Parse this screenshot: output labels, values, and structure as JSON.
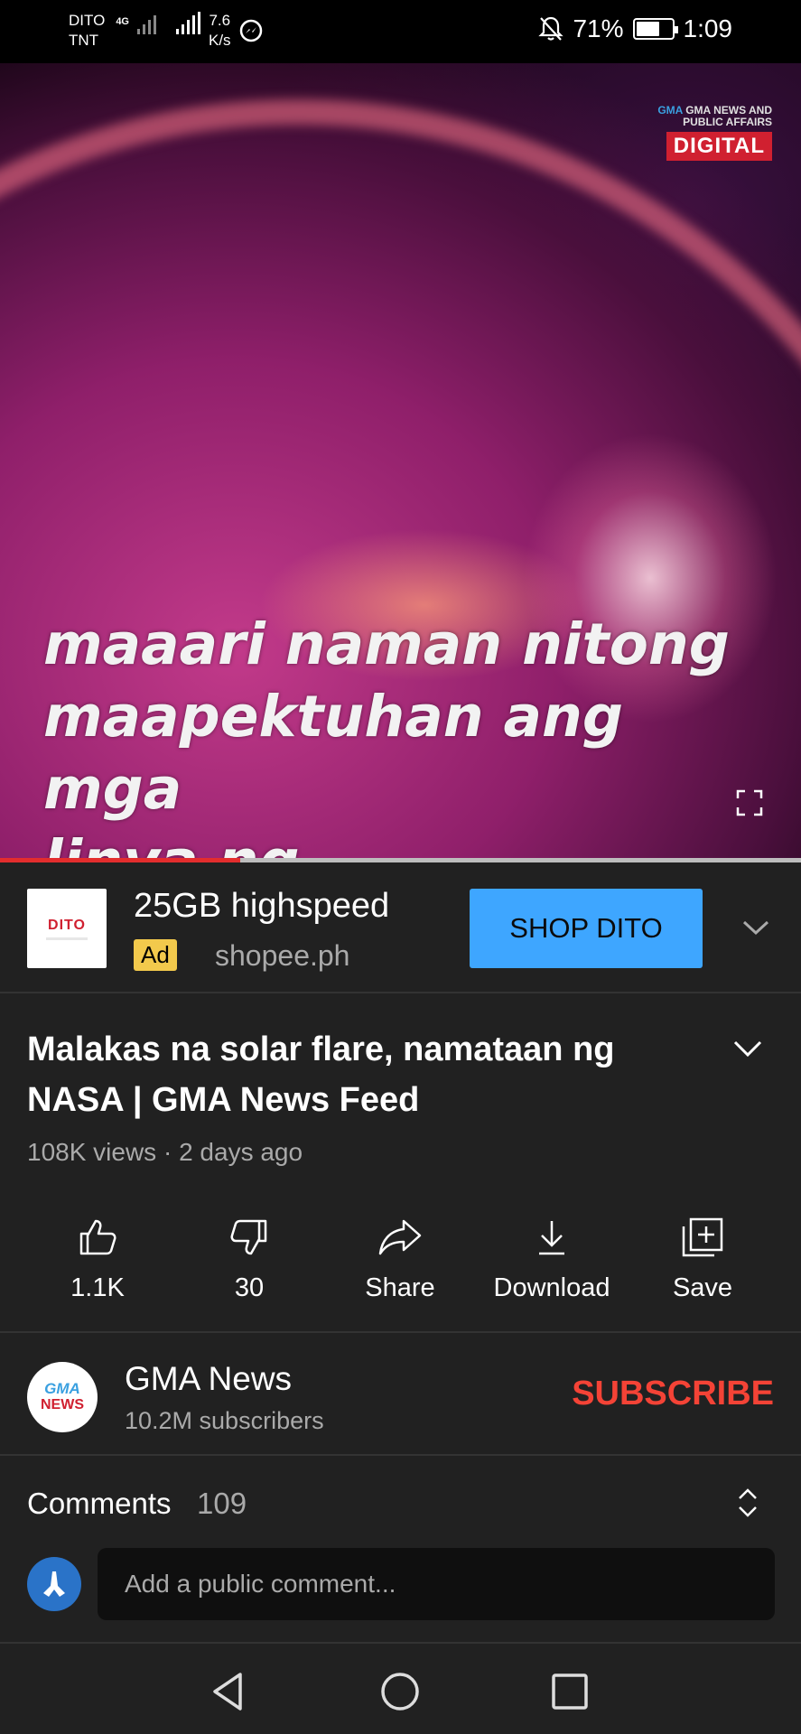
{
  "status_bar": {
    "carrier1": "DITO",
    "carrier2": "TNT",
    "network": "4G",
    "speed_value": "7.6",
    "speed_unit": "K/s",
    "battery_text": "71%",
    "battery_level": 0.71,
    "time": "1:09"
  },
  "video": {
    "channel_logo_line1": "GMA NEWS AND",
    "channel_logo_line2": "PUBLIC AFFAIRS",
    "channel_logo_digital": "DIGITAL",
    "caption_line1": "maaari naman nitong",
    "caption_line2": "maapektuhan ang mga",
    "caption_line3": "linya ng komunikasyon.",
    "progress": 0.3
  },
  "ad": {
    "logo_text": "DITO",
    "title": "25GB highspeed",
    "badge": "Ad",
    "domain": "shopee.ph",
    "cta": "SHOP DITO"
  },
  "video_info": {
    "title": "Malakas na solar flare, namataan ng NASA | GMA News Feed",
    "meta": "108K views · 2 days ago"
  },
  "actions": [
    {
      "label": "1.1K",
      "icon": "thumbs-up-icon"
    },
    {
      "label": "30",
      "icon": "thumbs-down-icon"
    },
    {
      "label": "Share",
      "icon": "share-icon"
    },
    {
      "label": "Download",
      "icon": "download-icon"
    },
    {
      "label": "Save",
      "icon": "save-playlist-icon"
    }
  ],
  "channel": {
    "avatar_line1": "GMA",
    "avatar_line2": "NEWS",
    "name": "GMA News",
    "subscribers": "10.2M subscribers",
    "subscribe_label": "SUBSCRIBE"
  },
  "comments": {
    "label": "Comments",
    "count": "109",
    "placeholder": "Add a public comment..."
  },
  "colors": {
    "accent_red": "#e32d2d",
    "cta_blue": "#3ea6ff",
    "subscribe_red": "#f44336",
    "background": "#212121"
  }
}
